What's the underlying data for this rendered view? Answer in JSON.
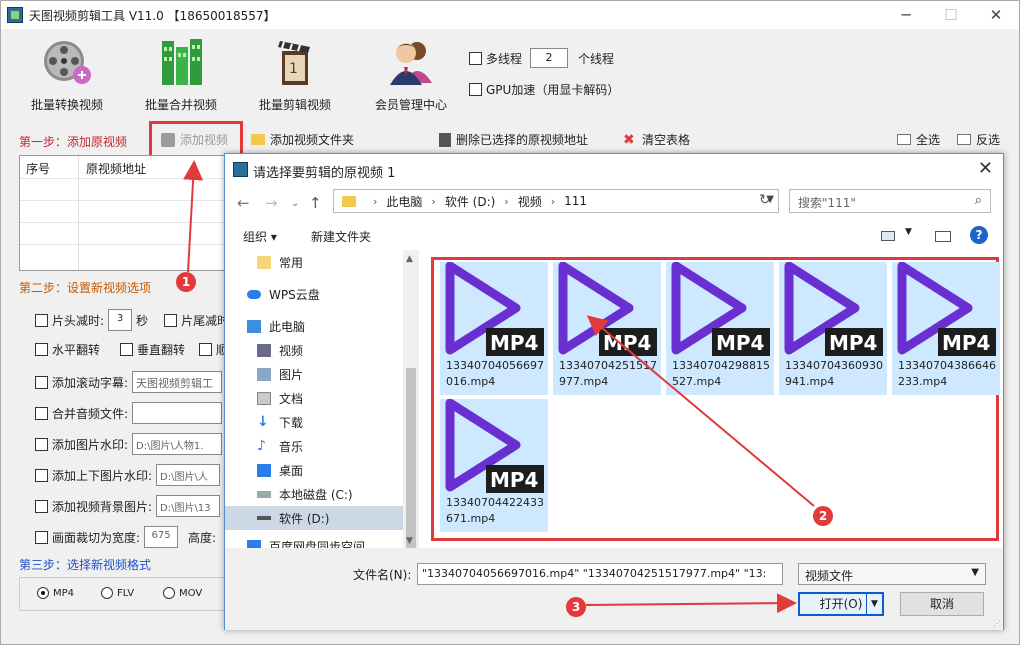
{
  "window": {
    "title": "天图视频剪辑工具 V11.0 【18650018557】",
    "minimize": "─",
    "maximize": "☐",
    "close": "✕"
  },
  "toolbar": {
    "items": [
      {
        "label": "批量转换视频",
        "icon": "film-reel-icon"
      },
      {
        "label": "批量合并视频",
        "icon": "building-blocks-icon"
      },
      {
        "label": "批量剪辑视频",
        "icon": "clapperboard-icon"
      },
      {
        "label": "会员管理中心",
        "icon": "users-icon"
      }
    ],
    "multithread_label": "多线程",
    "threads_value": "2",
    "threads_suffix": "个线程",
    "gpu_label": "GPU加速（用显卡解码）"
  },
  "step1": {
    "label": "第一步：添加原视频",
    "add_video": "添加视频",
    "add_folder": "添加视频文件夹",
    "delete_selected": "删除已选择的原视频地址",
    "clear_table": "清空表格",
    "select_all": "全选",
    "invert": "反选",
    "columns": [
      "序号",
      "原视频地址"
    ]
  },
  "step2": {
    "label": "第二步：设置新视频选项",
    "trim_head": "片头减时:",
    "trim_head_value": "3",
    "seconds": "秒",
    "trim_tail": "片尾减时",
    "hflip": "水平翻转",
    "vflip": "垂直翻转",
    "cw": "顺",
    "scroll_caption": "添加滚动字幕:",
    "scroll_caption_value": "天图视频剪辑工",
    "merge_audio": "合并音频文件:",
    "merge_audio_value": "",
    "image_watermark": "添加图片水印:",
    "image_watermark_value": "D:\\图片\\人物1.",
    "tb_watermark": "添加上下图片水印:",
    "tb_watermark_value": "D:\\图片\\人",
    "bg_image": "添加视频背景图片:",
    "bg_image_value": "D:\\图片\\13",
    "crop_width": "画面裁切为宽度:",
    "crop_width_value": "675",
    "height_label": "高度:"
  },
  "step3": {
    "label": "第三步：选择新视频格式",
    "formats": [
      "MP4",
      "FLV",
      "MOV"
    ],
    "selected": "MP4"
  },
  "dialog": {
    "title": "请选择要剪辑的原视频 1",
    "breadcrumb": [
      "此电脑",
      "软件 (D:)",
      "视频",
      "111"
    ],
    "search_placeholder": "搜索\"111\"",
    "organize": "组织 ▾",
    "new_folder": "新建文件夹",
    "tree": [
      {
        "label": "常用",
        "icon": "folder-icon"
      },
      {
        "label": "WPS云盘",
        "icon": "cloud-icon"
      },
      {
        "label": "此电脑",
        "icon": "computer-icon"
      },
      {
        "label": "视频",
        "icon": "video-folder-icon"
      },
      {
        "label": "图片",
        "icon": "pictures-folder-icon"
      },
      {
        "label": "文档",
        "icon": "documents-folder-icon"
      },
      {
        "label": "下载",
        "icon": "download-icon"
      },
      {
        "label": "音乐",
        "icon": "music-icon"
      },
      {
        "label": "桌面",
        "icon": "desktop-icon"
      },
      {
        "label": "本地磁盘 (C:)",
        "icon": "drive-icon"
      },
      {
        "label": "软件 (D:)",
        "icon": "drive-icon"
      },
      {
        "label": "百度网盘同步空间",
        "icon": "cloud-icon"
      }
    ],
    "files": [
      {
        "name": "13340704056697016.mp4",
        "badge": "MP4"
      },
      {
        "name": "13340704251517977.mp4",
        "badge": "MP4"
      },
      {
        "name": "13340704298815527.mp4",
        "badge": "MP4"
      },
      {
        "name": "13340704360930941.mp4",
        "badge": "MP4"
      },
      {
        "name": "13340704386646233.mp4",
        "badge": "MP4"
      },
      {
        "name": "13340704422433671.mp4",
        "badge": "MP4"
      }
    ],
    "filename_label": "文件名(N):",
    "filename_value": "\"13340704056697016.mp4\" \"13340704251517977.mp4\" \"13:",
    "filetype": "视频文件",
    "open": "打开(O)",
    "cancel": "取消"
  },
  "annotations": [
    "1",
    "2",
    "3"
  ],
  "colors": {
    "accent_red": "#e23a3a",
    "play_purple": "#6a2fd0",
    "tile_selected": "#cde8ff"
  }
}
